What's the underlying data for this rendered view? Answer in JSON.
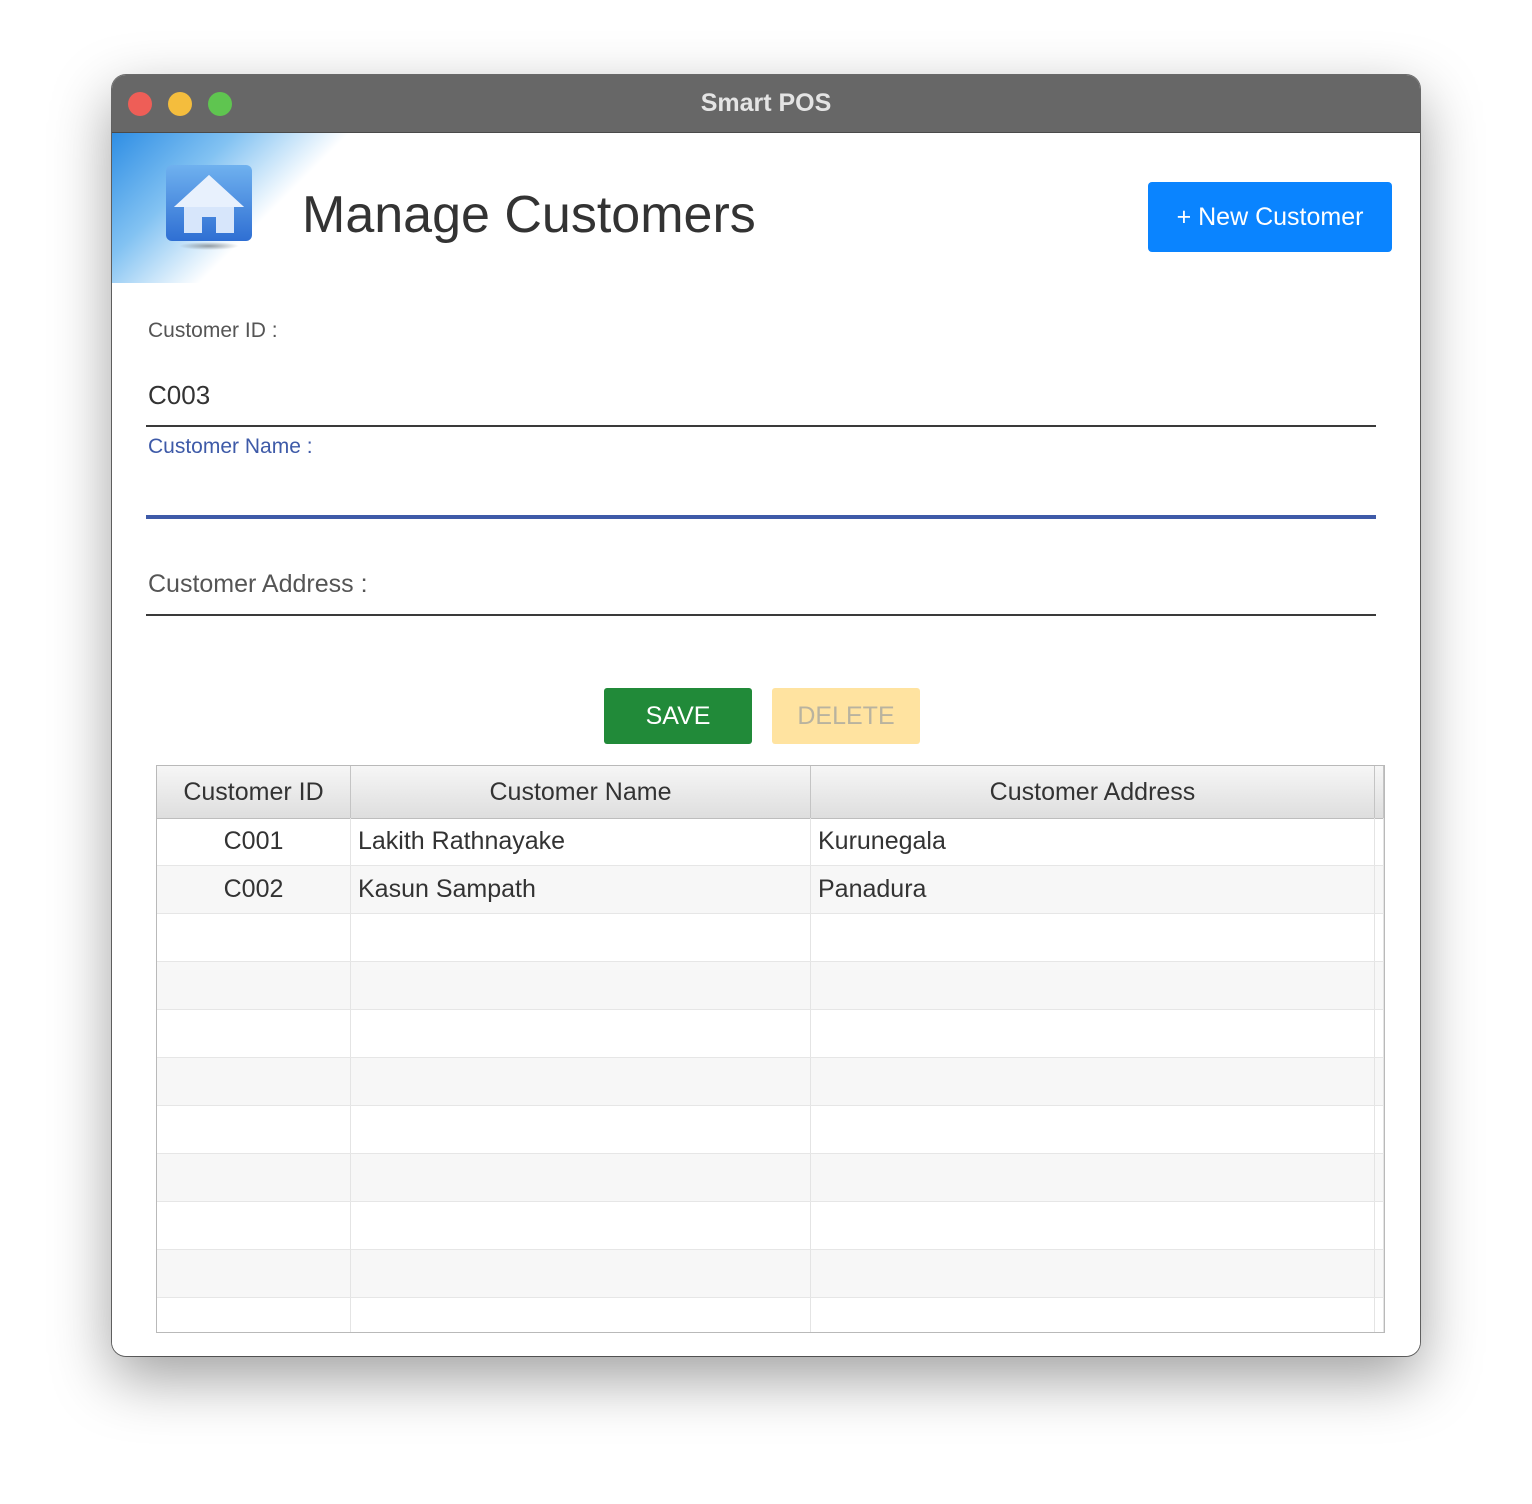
{
  "window": {
    "title": "Smart POS"
  },
  "header": {
    "title": "Manage Customers",
    "new_button_label": "+ New Customer",
    "icon": "home-icon"
  },
  "form": {
    "customer_id_label": "Customer ID :",
    "customer_id_value": "C003",
    "customer_name_label": "Customer Name :",
    "customer_name_value": "",
    "customer_address_label": "Customer Address :",
    "customer_address_value": ""
  },
  "actions": {
    "save_label": "SAVE",
    "delete_label": "DELETE"
  },
  "table": {
    "columns": [
      "Customer ID",
      "Customer Name",
      "Customer Address"
    ],
    "rows": [
      [
        "C001",
        "Lakith Rathnayake",
        "Kurunegala"
      ],
      [
        "C002",
        "Kasun Sampath",
        "Panadura"
      ]
    ]
  },
  "colors": {
    "accent": "#0a84ff",
    "save": "#218a39",
    "delete": "#ffe3a0",
    "focus": "#3e5aa8",
    "titlebar": "#676767"
  }
}
